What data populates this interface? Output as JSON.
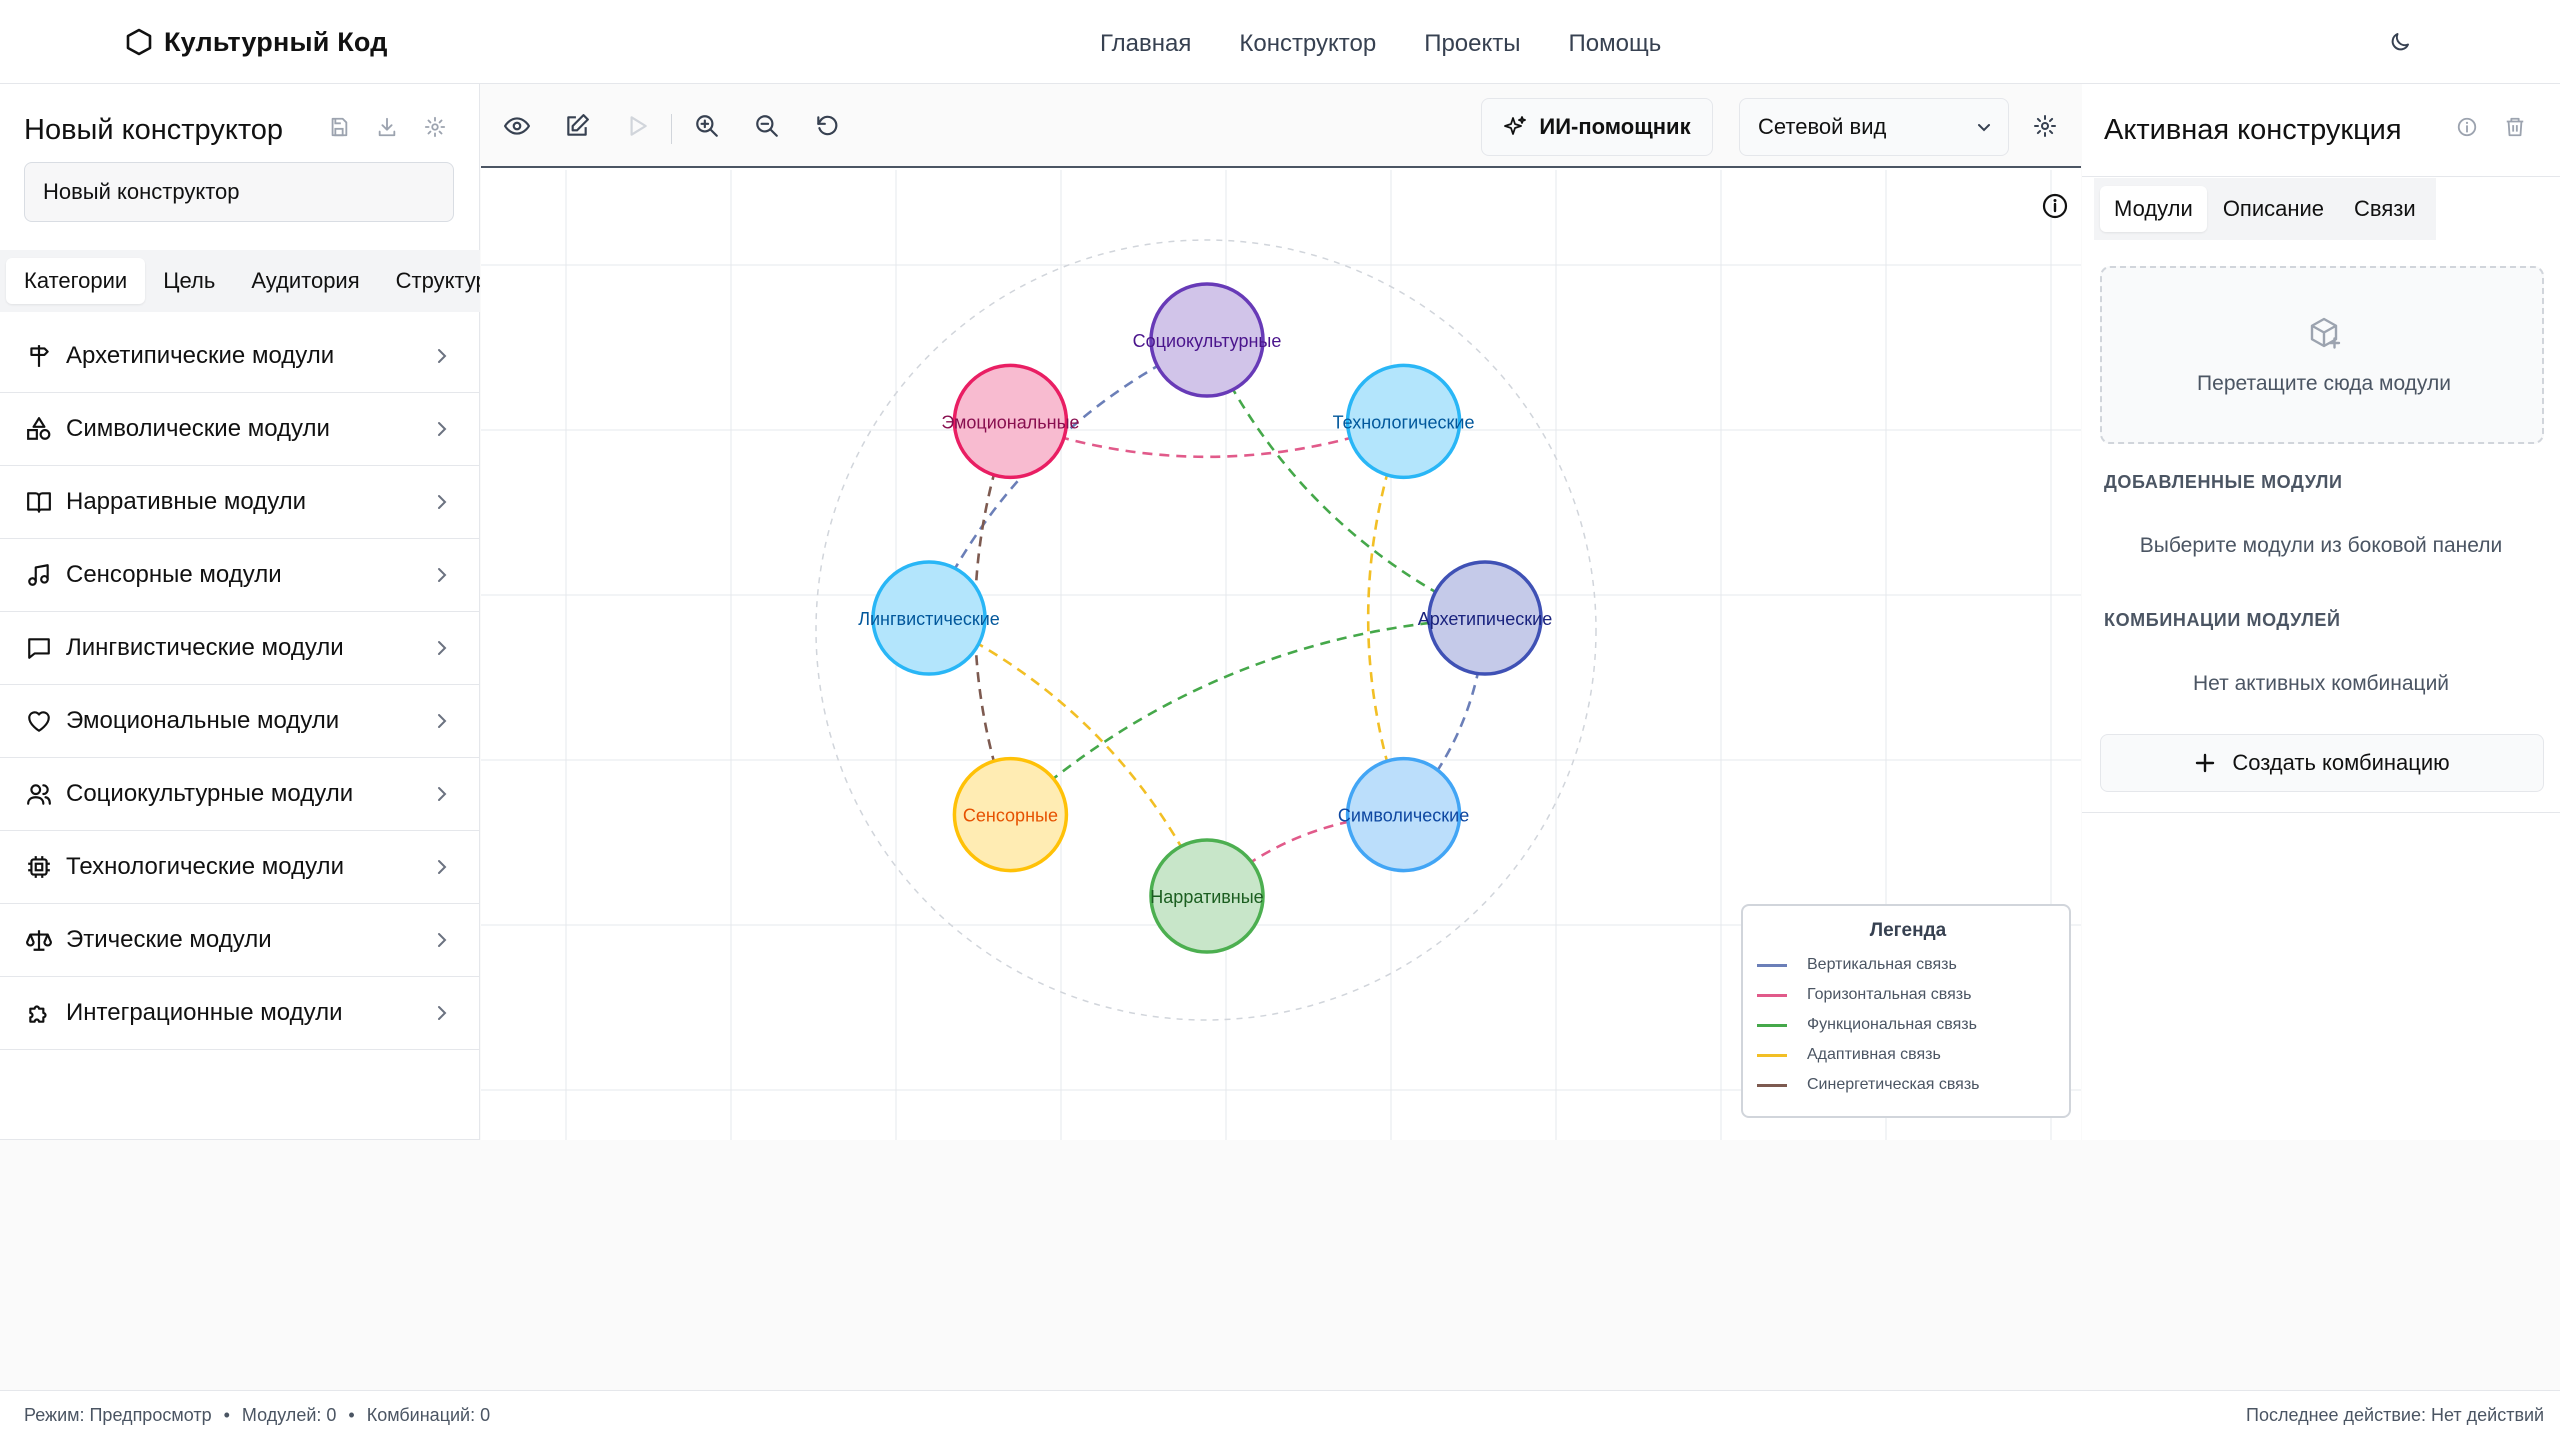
{
  "app": {
    "brand": "Культурный Код",
    "nav": [
      "Главная",
      "Конструктор",
      "Проекты",
      "Помощь"
    ]
  },
  "sidebar": {
    "title": "Новый конструктор",
    "name_value": "Новый конструктор",
    "tabs": [
      "Категории",
      "Цель",
      "Аудитория",
      "Структура"
    ],
    "modules": [
      {
        "label": "Архетипические модули",
        "icon": "signpost-icon"
      },
      {
        "label": "Символические модули",
        "icon": "shapes-icon"
      },
      {
        "label": "Нарративные модули",
        "icon": "book-icon"
      },
      {
        "label": "Сенсорные модули",
        "icon": "music-note-icon"
      },
      {
        "label": "Лингвистические модули",
        "icon": "message-square-icon"
      },
      {
        "label": "Эмоциональные модули",
        "icon": "heart-icon"
      },
      {
        "label": "Социокультурные модули",
        "icon": "users-icon"
      },
      {
        "label": "Технологические модули",
        "icon": "cpu-icon"
      },
      {
        "label": "Этические модули",
        "icon": "scale-icon"
      },
      {
        "label": "Интеграционные модули",
        "icon": "puzzle-icon"
      }
    ]
  },
  "toolbar": {
    "ai_label": "ИИ-помощник",
    "view_value": "Сетевой вид"
  },
  "graph": {
    "nodes": [
      {
        "id": "socio",
        "label": "Социокультурные",
        "fill": "#d1c4e9",
        "stroke": "#673ab7",
        "text": "#4a148c"
      },
      {
        "id": "tech",
        "label": "Технологические",
        "fill": "#b3e5fc",
        "stroke": "#29b6f6",
        "text": "#01579b"
      },
      {
        "id": "arch",
        "label": "Архетипические",
        "fill": "#c5cae9",
        "stroke": "#3f51b5",
        "text": "#1a237e"
      },
      {
        "id": "symb",
        "label": "Символические",
        "fill": "#bbdefb",
        "stroke": "#42a5f5",
        "text": "#0d47a1"
      },
      {
        "id": "narr",
        "label": "Нарративные",
        "fill": "#c8e6c9",
        "stroke": "#4caf50",
        "text": "#1b5e20"
      },
      {
        "id": "sens",
        "label": "Сенсорные",
        "fill": "#ffecb3",
        "stroke": "#ffc107",
        "text": "#e65100"
      },
      {
        "id": "ling",
        "label": "Лингвистические",
        "fill": "#b3e5fc",
        "stroke": "#29b6f6",
        "text": "#01579b"
      },
      {
        "id": "emo",
        "label": "Эмоциональные",
        "fill": "#f8bbd0",
        "stroke": "#e91e63",
        "text": "#880e4f"
      }
    ],
    "links": [
      {
        "from": "socio",
        "to": "ling",
        "type": "vertical"
      },
      {
        "from": "arch",
        "to": "symb",
        "type": "vertical"
      },
      {
        "from": "emo",
        "to": "tech",
        "type": "horizontal"
      },
      {
        "from": "narr",
        "to": "symb",
        "type": "horizontal"
      },
      {
        "from": "socio",
        "to": "arch",
        "type": "functional"
      },
      {
        "from": "sens",
        "to": "arch",
        "type": "functional"
      },
      {
        "from": "tech",
        "to": "symb",
        "type": "adaptive"
      },
      {
        "from": "ling",
        "to": "narr",
        "type": "adaptive"
      },
      {
        "from": "emo",
        "to": "sens",
        "type": "synergetic"
      }
    ],
    "link_colors": {
      "vertical": "#6b7fb8",
      "horizontal": "#e15a8a",
      "functional": "#45a84a",
      "adaptive": "#f2bf25",
      "synergetic": "#7d5a50"
    }
  },
  "legend": {
    "title": "Легенда",
    "items": [
      {
        "label": "Вертикальная связь",
        "color": "#6b7fb8"
      },
      {
        "label": "Горизонтальная связь",
        "color": "#e15a8a"
      },
      {
        "label": "Функциональная связь",
        "color": "#45a84a"
      },
      {
        "label": "Адаптивная связь",
        "color": "#f2bf25"
      },
      {
        "label": "Синергетическая связь",
        "color": "#7d5a50"
      }
    ]
  },
  "panel": {
    "title": "Активная конструкция",
    "tabs": [
      "Модули",
      "Описание",
      "Связи"
    ],
    "dropzone_text": "Перетащите сюда модули",
    "added_heading": "ДОБАВЛЕННЫЕ МОДУЛИ",
    "added_empty": "Выберите модули из боковой панели",
    "combos_heading": "КОМБИНАЦИИ МОДУЛЕЙ",
    "combos_empty": "Нет активных комбинаций",
    "create_label": "Создать комбинацию"
  },
  "status": {
    "mode": "Режим: Предпросмотр",
    "modules": "Модулей: 0",
    "combos": "Комбинаций: 0",
    "last_action": "Последнее действие: Нет действий",
    "separator": "•"
  }
}
